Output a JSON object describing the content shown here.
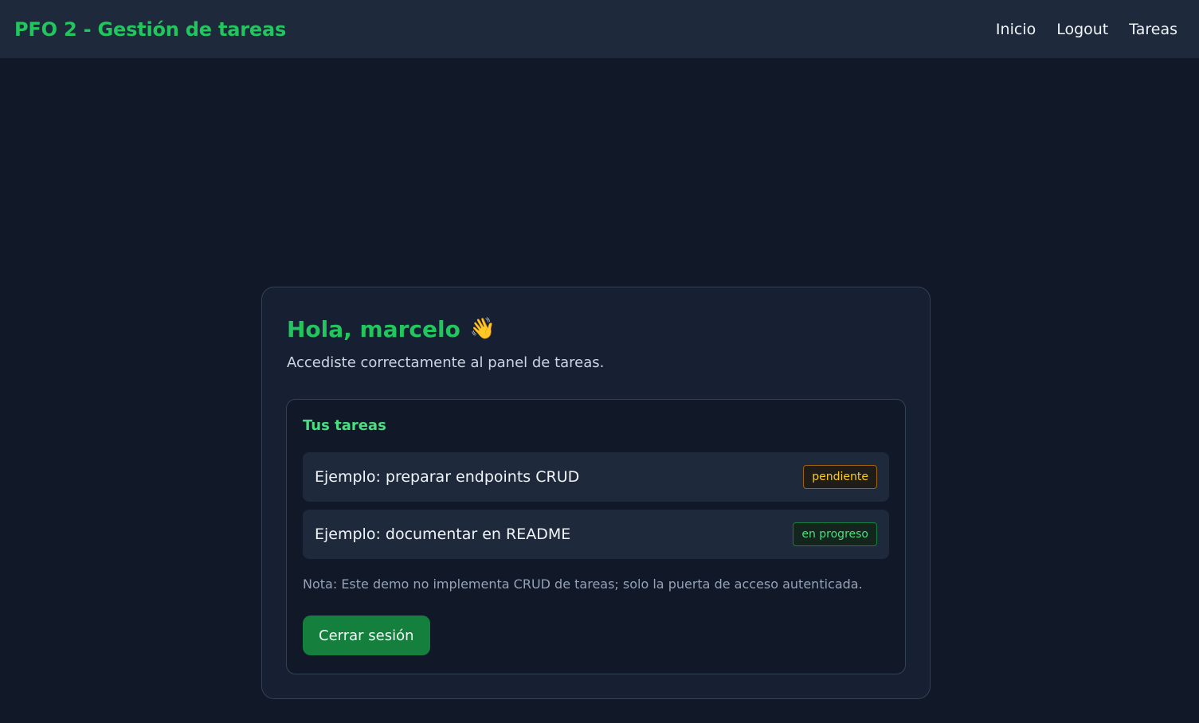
{
  "navbar": {
    "brand": "PFO 2 - Gestión de tareas",
    "links": [
      {
        "label": "Inicio"
      },
      {
        "label": "Logout"
      },
      {
        "label": "Tareas"
      }
    ]
  },
  "card": {
    "greeting": "Hola, marcelo",
    "greeting_emoji": "👋",
    "subtitle": "Accediste correctamente al panel de tareas."
  },
  "tasks": {
    "title": "Tus tareas",
    "items": [
      {
        "title": "Ejemplo: preparar endpoints CRUD",
        "status": "pendiente",
        "status_color": "#facc15"
      },
      {
        "title": "Ejemplo: documentar en README",
        "status": "en progreso",
        "status_color": "#4ade80"
      }
    ],
    "note": "Nota: Este demo no implementa CRUD de tareas; solo la puerta de acceso autenticada.",
    "logout_label": "Cerrar sesión"
  },
  "colors": {
    "background": "#111827",
    "navbar": "#1e293b",
    "accent": "#22c55e",
    "button": "#15803d"
  },
  "icons": {
    "wave": "waving-hand-icon"
  }
}
